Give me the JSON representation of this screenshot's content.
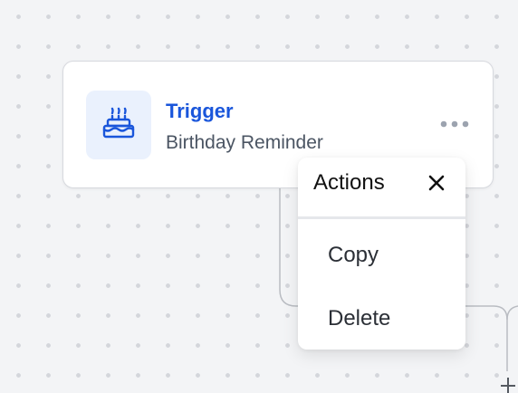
{
  "trigger_card": {
    "title": "Trigger",
    "subtitle": "Birthday Reminder",
    "icon": "cake-icon",
    "accent_color": "#1a56db"
  },
  "actions_menu": {
    "title": "Actions",
    "close_icon": "close-icon",
    "items": [
      {
        "label": "Copy"
      },
      {
        "label": "Delete"
      }
    ]
  },
  "canvas": {
    "add_icon": "plus-icon"
  }
}
